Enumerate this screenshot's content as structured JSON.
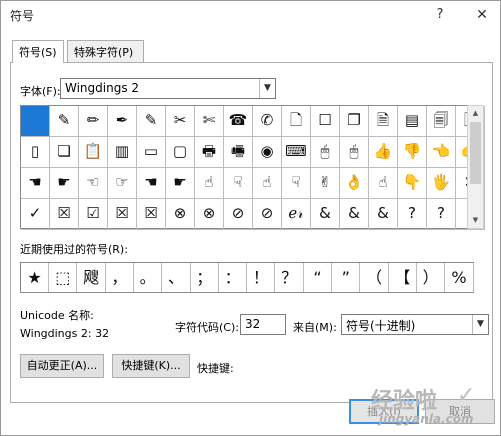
{
  "window": {
    "title": "符号",
    "help": "?",
    "close": "✕"
  },
  "tabs": [
    "符号(S)",
    "特殊字符(P)"
  ],
  "font": {
    "label": "字体(F):",
    "value": "Wingdings 2"
  },
  "grid": [
    [
      "",
      "✎",
      "✏",
      "✒",
      "✎",
      "✂",
      "✄",
      "☎",
      "✆",
      "🗋",
      "☐",
      "❐",
      "🗎",
      "▤",
      "🗐",
      "🗋"
    ],
    [
      "▯",
      "❏",
      "📋",
      "▥",
      "▭",
      "▢",
      "🖶",
      "🖷",
      "◉",
      "⌨",
      "🖱",
      "🖱",
      "👍",
      "👎",
      "👈",
      "👉"
    ],
    [
      "☚",
      "☛",
      "☜",
      "☞",
      "☚",
      "☛",
      "☝",
      "☟",
      "☝",
      "☟",
      "✌",
      "👌",
      "☝",
      "👇",
      "🖐",
      "✕"
    ],
    [
      "✓",
      "☒",
      "☑",
      "☒",
      "☒",
      "⊗",
      "⊗",
      "⊘",
      "⊘",
      "ℯ𝓇",
      "&",
      "&",
      "&",
      "?",
      "?",
      "?"
    ]
  ],
  "recent": {
    "label": "近期使用过的符号(R):",
    "items": [
      "★",
      "⬚",
      "飕",
      "，",
      "。",
      "、",
      "；",
      "：",
      "！",
      "？",
      "“",
      "”",
      "（",
      "【",
      "）",
      "%"
    ]
  },
  "unicode": {
    "label": "Unicode 名称:",
    "value": "Wingdings 2: 32"
  },
  "charcode": {
    "label": "字符代码(C):",
    "value": "32"
  },
  "from": {
    "label": "来自(M):",
    "value": "符号(十进制)"
  },
  "buttons": {
    "autocorrect": "自动更正(A)...",
    "shortcut": "快捷键(K)...",
    "shortcut_label": "快捷键:",
    "insert": "插入(I)",
    "cancel": "取消"
  },
  "watermark": {
    "cn": "经验啦",
    "en": "jingyanla.com",
    "check": "✓"
  }
}
